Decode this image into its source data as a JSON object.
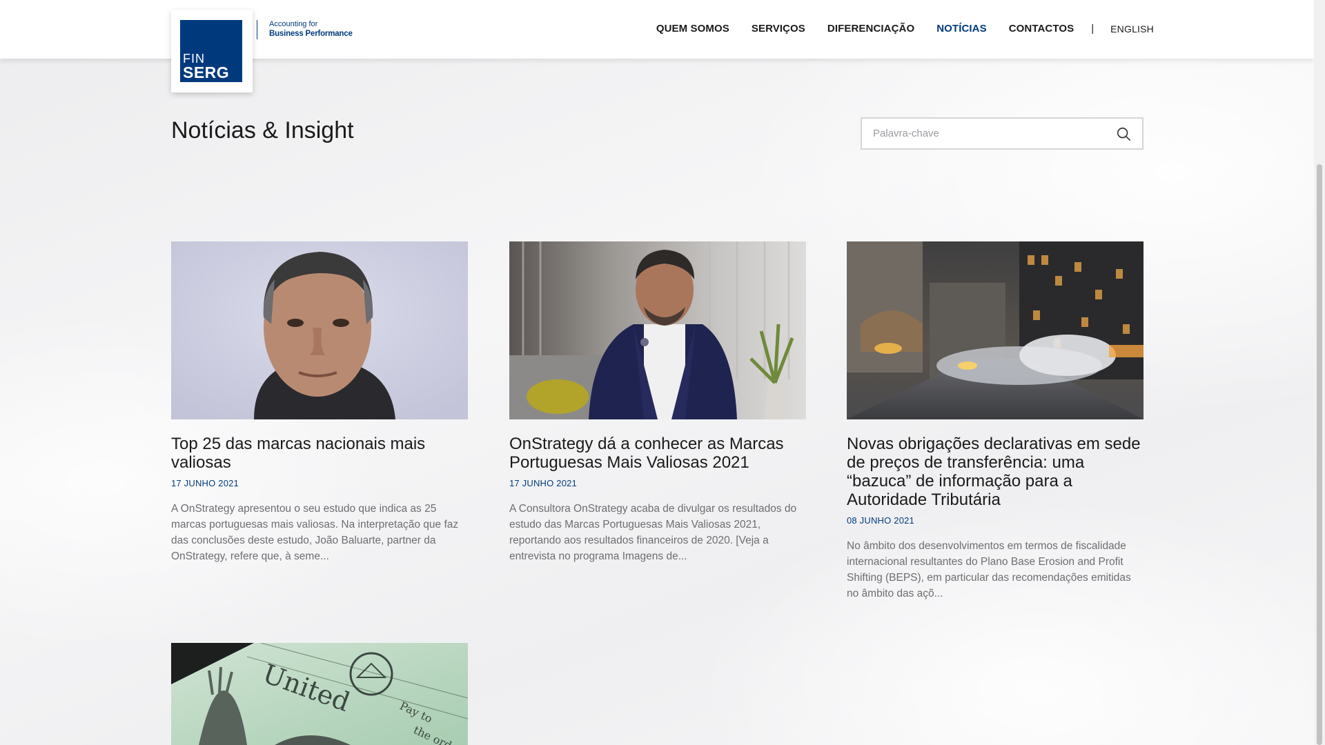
{
  "brand": {
    "logo_top": "FIN",
    "logo_bottom": "SERG",
    "tagline_line1": "Accounting for",
    "tagline_line2": "Business Performance",
    "primary_color": "#003a7d"
  },
  "nav": {
    "items": [
      {
        "label": "QUEM SOMOS"
      },
      {
        "label": "SERVIÇOS"
      },
      {
        "label": "DIFERENCIAÇÃO"
      },
      {
        "label": "NOTÍCIAS",
        "active": true
      },
      {
        "label": "CONTACTOS"
      }
    ],
    "separator": "|",
    "language": "ENGLISH"
  },
  "page": {
    "title": "Notícias & Insight"
  },
  "search": {
    "placeholder": "Palavra-chave",
    "value": "",
    "icon": "search-icon"
  },
  "articles": [
    {
      "title": "Top 25 das marcas nacionais mais valiosas",
      "date": "17 JUNHO 2021",
      "excerpt": "A OnStrategy apresentou o seu estudo que indica as 25 marcas portuguesas mais valiosas. Na interpretação que faz das conclusões deste estudo, João Baluarte, partner da OnStrategy, refere que, à seme..."
    },
    {
      "title": "OnStrategy dá a conhecer as Marcas Portuguesas Mais Valiosas 2021",
      "date": "17 JUNHO 2021",
      "excerpt": "A Consultora OnStrategy acaba de divulgar os resultados do estudo das Marcas Portuguesas Mais Valiosas 2021, reportando aos resultados financeiros de 2020. [Veja a entrevista no programa Imagens de..."
    },
    {
      "title": "Novas obrigações declarativas em sede de preços de transferência: uma “bazuca” de informação para a Autoridade Tributária",
      "date": "08 JUNHO 2021",
      "excerpt": "No âmbito dos desenvolvimentos em termos de fiscalidade internacional resultantes do Plano Base Erosion and Profit Shifting (BEPS), em particular das recomendações emitidas no âmbito das açõ..."
    },
    {
      "title": "",
      "date": "",
      "excerpt": ""
    }
  ]
}
